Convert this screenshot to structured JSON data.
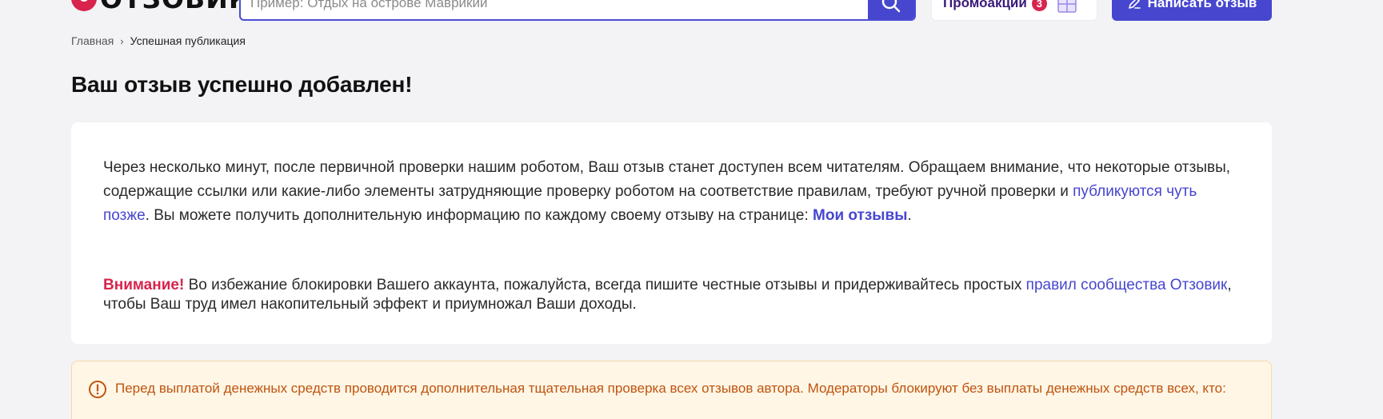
{
  "header": {
    "logo_text": "ОТЗОВИК",
    "search_placeholder": "Пример: Отдых на острове Маврикий",
    "promo_label": "Промоакции",
    "promo_count": "3",
    "write_label": "Написать отзыв"
  },
  "breadcrumb": {
    "home": "Главная",
    "separator": "›",
    "current": "Успешная публикация"
  },
  "page_title": "Ваш отзыв успешно добавлен!",
  "info": {
    "text_1": "Через несколько минут, после первичной проверки нашим роботом, Ваш отзыв станет доступен всем читателям. Обращаем внимание, что некоторые отзывы, содержащие ссылки или какие-либо элементы затрудняющие проверку роботом на соответствие правилам, требуют ручной проверки и ",
    "link_later": "публикуются чуть позже",
    "text_2": ". Вы можете получить дополнительную информацию по каждому своему отзыву на странице: ",
    "link_my_reviews": "Мои отзывы",
    "text_3": "."
  },
  "warning": {
    "label": "Внимание!",
    "text_1": " Во избежание блокировки Вашего аккаунта, пожалуйста, всегда пишите честные отзывы и придерживайтесь простых ",
    "link_rules": "правил сообщества Отзовик",
    "text_2": ", чтобы Ваш труд имел накопительный эффект и приумножал Ваши доходы."
  },
  "notice": {
    "text": "Перед выплатой денежных средств проводится дополнительная тщательная проверка всех отзывов автора. Модераторы блокируют без выплаты денежных средств всех, кто:"
  },
  "colors": {
    "accent": "#4646cf",
    "brand": "#d8234d",
    "notice_text": "#c0540e",
    "notice_bg": "#fff6e6",
    "page_bg": "#f3f3f6"
  }
}
